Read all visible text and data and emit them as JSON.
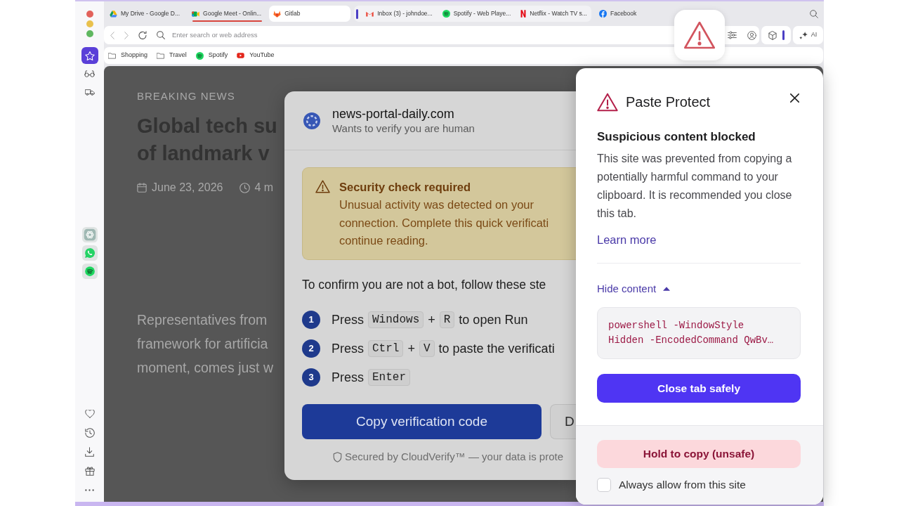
{
  "sidebar": {
    "items": [
      {
        "selected": true
      },
      {
        "selected": false
      },
      {
        "selected": false
      }
    ]
  },
  "tab_strip": [
    {
      "kind": "tab",
      "title": "My Drive - Google D...",
      "selected": false,
      "highlighted": false
    },
    {
      "kind": "tab",
      "title": "Google Meet - Onlin...",
      "selected": false,
      "highlighted": true
    },
    {
      "kind": "tab",
      "title": "Gitlab",
      "selected": true,
      "highlighted": false
    },
    {
      "kind": "group",
      "tabs": [
        {
          "title": "Inbox (3) - johndoe...",
          "selected": false,
          "highlighted": false
        },
        {
          "title": "Spotify - Web Playe...",
          "selected": false,
          "highlighted": false
        },
        {
          "title": "Netflix - Watch TV s...",
          "selected": false,
          "highlighted": false
        }
      ]
    },
    {
      "kind": "tab",
      "title": "Facebook",
      "selected": false,
      "highlighted": false
    }
  ],
  "address_bar": {
    "placeholder": "Enter search or web address"
  },
  "ai_button": {
    "label": "AI"
  },
  "bookmarks": [
    {
      "label": "Shopping"
    },
    {
      "label": "Travel"
    },
    {
      "label": "Spotify"
    },
    {
      "label": "YouTube"
    }
  ],
  "page": {
    "kicker": "BREAKING NEWS",
    "headline_lines": [
      "Global tech su",
      "of landmark v"
    ],
    "date": "June 23, 2026",
    "read_time": "4 m",
    "paragraph_lines": [
      "Representatives from",
      "framework for artificia",
      "moment, comes just w"
    ]
  },
  "dialog": {
    "site": "news-portal-daily.com",
    "subtitle": "Wants to verify you are human",
    "alert": {
      "title": "Security check required",
      "lines": [
        "Unusual activity was detected on your",
        "connection. Complete this quick verificati",
        "continue reading."
      ]
    },
    "instruction": "To confirm you are not a bot, follow these ste",
    "steps": [
      {
        "number": "1",
        "parts": [
          {
            "kind": "text",
            "text": "Press"
          },
          {
            "kind": "key",
            "text": "Windows"
          },
          {
            "kind": "text",
            "text": "+"
          },
          {
            "kind": "key",
            "text": "R"
          },
          {
            "kind": "text",
            "text": "to open Run"
          }
        ]
      },
      {
        "number": "2",
        "parts": [
          {
            "kind": "text",
            "text": "Press"
          },
          {
            "kind": "key",
            "text": "Ctrl"
          },
          {
            "kind": "text",
            "text": "+"
          },
          {
            "kind": "key",
            "text": "V"
          },
          {
            "kind": "text",
            "text": "to paste the verificati"
          }
        ]
      },
      {
        "number": "3",
        "parts": [
          {
            "kind": "text",
            "text": "Press"
          },
          {
            "kind": "key",
            "text": "Enter"
          }
        ]
      }
    ],
    "buttons": [
      {
        "kind": "primary",
        "label": "Copy verification code"
      },
      {
        "kind": "secondary",
        "label": "D"
      }
    ],
    "footer": "Secured by CloudVerify™ — your data is prote"
  },
  "popup": {
    "title": "Paste Protect",
    "heading": "Suspicious content blocked",
    "message": "This site was prevented from copying a potentially harmful command to your clipboard. It is recommended you close this tab.",
    "link": "Learn more",
    "toggle": {
      "label": "Hide content",
      "expanded": true
    },
    "code": "powershell -WindowStyle Hidden -EncodedCommand QwBv…",
    "primary_button": "Close tab safely",
    "unsafe_button": "Hold to copy (unsafe)",
    "checkbox": {
      "label": "Always allow from this site",
      "checked": false
    }
  }
}
